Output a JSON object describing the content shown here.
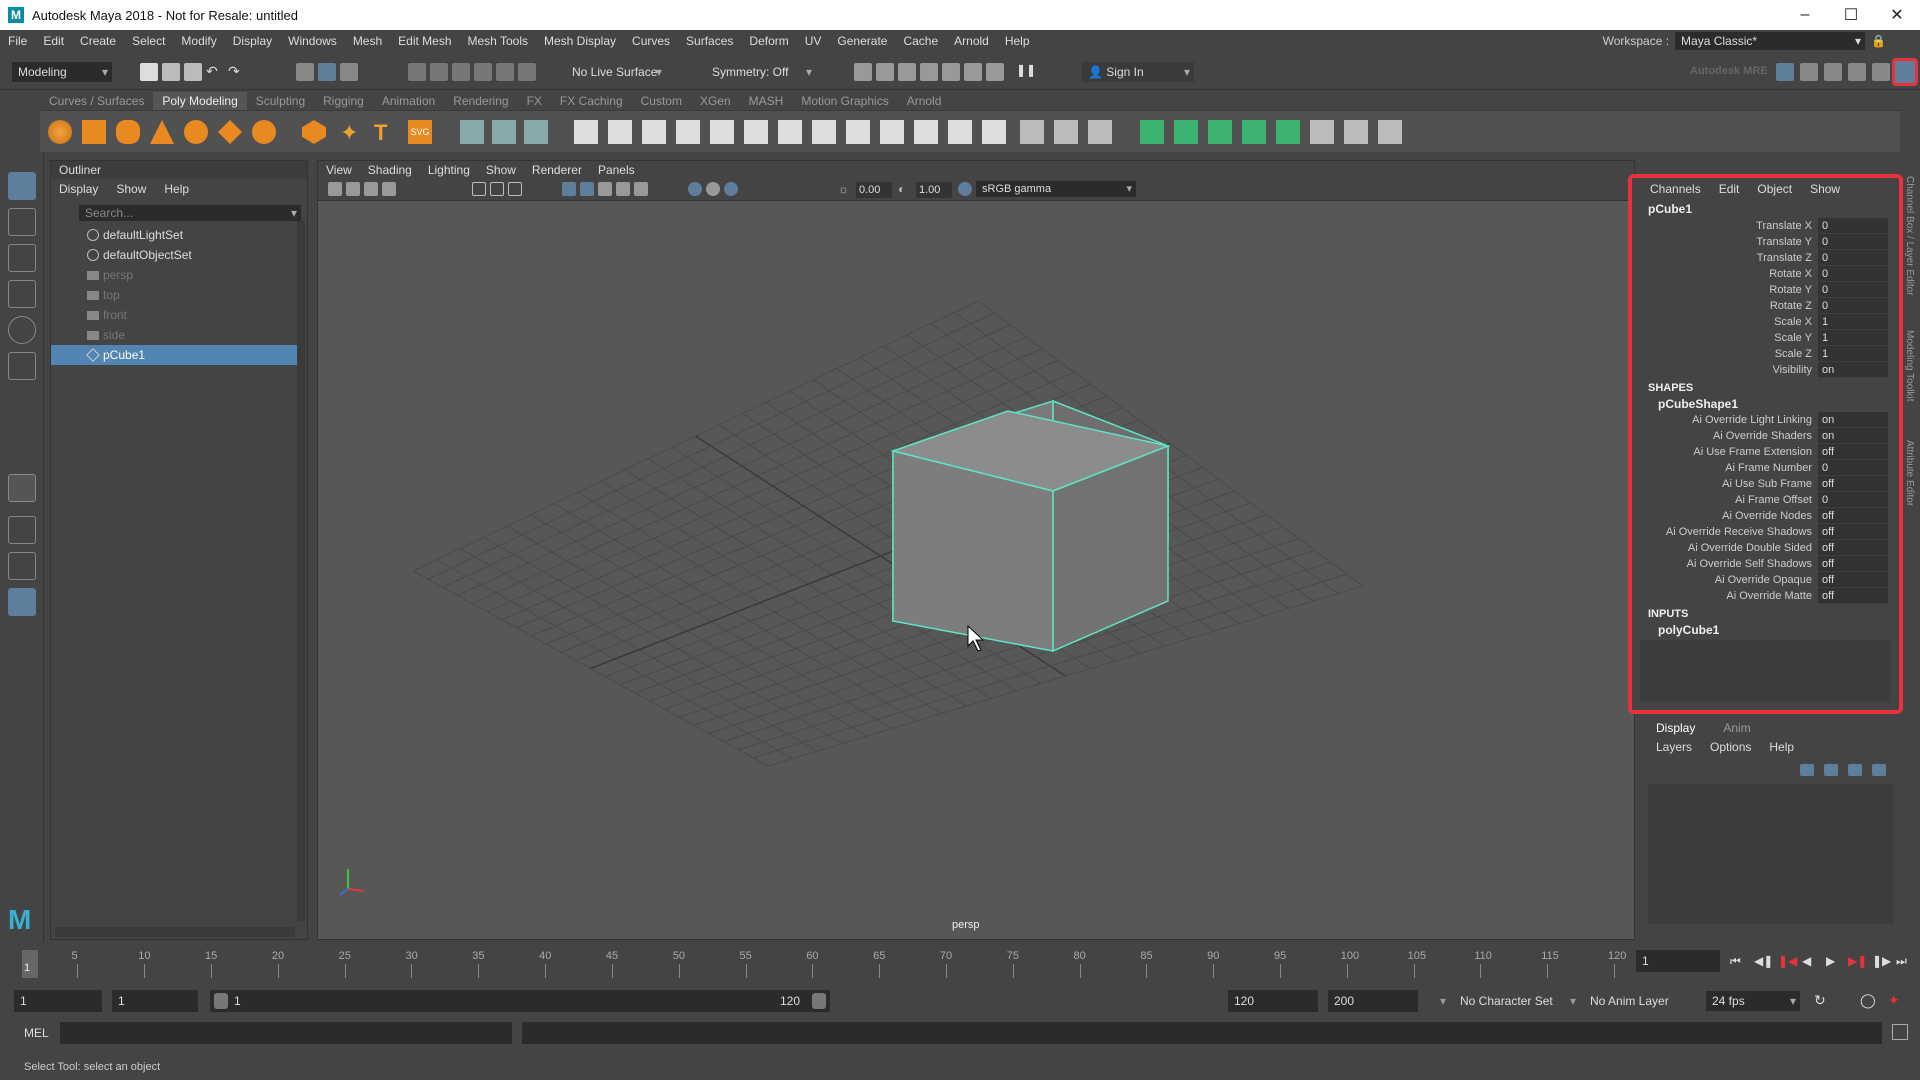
{
  "window": {
    "title": "Autodesk Maya 2018 - Not for Resale: untitled",
    "logo_letter": "M"
  },
  "menubar": {
    "items": [
      "File",
      "Edit",
      "Create",
      "Select",
      "Modify",
      "Display",
      "Windows",
      "Mesh",
      "Edit Mesh",
      "Mesh Tools",
      "Mesh Display",
      "Curves",
      "Surfaces",
      "Deform",
      "UV",
      "Generate",
      "Cache",
      "Arnold",
      "Help"
    ],
    "workspace_label": "Workspace :",
    "workspace_value": "Maya Classic*"
  },
  "statusline": {
    "mode": "Modeling",
    "live_surface": "No Live Surface",
    "symmetry": "Symmetry: Off",
    "sign_in": "Sign In",
    "autodesk_mre": "Autodesk MRE"
  },
  "shelf": {
    "tabs": [
      "Curves / Surfaces",
      "Poly Modeling",
      "Sculpting",
      "Rigging",
      "Animation",
      "Rendering",
      "FX",
      "FX Caching",
      "Custom",
      "XGen",
      "MASH",
      "Motion Graphics",
      "Arnold"
    ],
    "active_tab": "Poly Modeling"
  },
  "outliner": {
    "title": "Outliner",
    "menu": [
      "Display",
      "Show",
      "Help"
    ],
    "search_placeholder": "Search...",
    "items": [
      {
        "label": "defaultLightSet",
        "dim": false,
        "selected": false,
        "icon": "set-icon"
      },
      {
        "label": "defaultObjectSet",
        "dim": false,
        "selected": false,
        "icon": "set-icon"
      },
      {
        "label": "persp",
        "dim": true,
        "selected": false,
        "icon": "camera-icon"
      },
      {
        "label": "top",
        "dim": true,
        "selected": false,
        "icon": "camera-icon"
      },
      {
        "label": "front",
        "dim": true,
        "selected": false,
        "icon": "camera-icon"
      },
      {
        "label": "side",
        "dim": true,
        "selected": false,
        "icon": "camera-icon"
      },
      {
        "label": "pCube1",
        "dim": false,
        "selected": true,
        "icon": "transform-icon"
      }
    ]
  },
  "viewport": {
    "menu": [
      "View",
      "Shading",
      "Lighting",
      "Show",
      "Renderer",
      "Panels"
    ],
    "exposure": "0.00",
    "gamma": "1.00",
    "color_space": "sRGB gamma",
    "camera_label": "persp"
  },
  "channelbox": {
    "menu": [
      "Channels",
      "Edit",
      "Object",
      "Show"
    ],
    "object": "pCube1",
    "transform": [
      {
        "label": "Translate X",
        "value": "0"
      },
      {
        "label": "Translate Y",
        "value": "0"
      },
      {
        "label": "Translate Z",
        "value": "0"
      },
      {
        "label": "Rotate X",
        "value": "0"
      },
      {
        "label": "Rotate Y",
        "value": "0"
      },
      {
        "label": "Rotate Z",
        "value": "0"
      },
      {
        "label": "Scale X",
        "value": "1"
      },
      {
        "label": "Scale Y",
        "value": "1"
      },
      {
        "label": "Scale Z",
        "value": "1"
      },
      {
        "label": "Visibility",
        "value": "on"
      }
    ],
    "shapes_header": "SHAPES",
    "shape_name": "pCubeShape1",
    "shape_attrs": [
      {
        "label": "Ai Override Light Linking",
        "value": "on"
      },
      {
        "label": "Ai Override Shaders",
        "value": "on"
      },
      {
        "label": "Ai Use Frame Extension",
        "value": "off"
      },
      {
        "label": "Ai Frame Number",
        "value": "0"
      },
      {
        "label": "Ai Use Sub Frame",
        "value": "off"
      },
      {
        "label": "Ai Frame Offset",
        "value": "0"
      },
      {
        "label": "Ai Override Nodes",
        "value": "off"
      },
      {
        "label": "Ai Override Receive Shadows",
        "value": "off"
      },
      {
        "label": "Ai Override Double Sided",
        "value": "off"
      },
      {
        "label": "Ai Override Self Shadows",
        "value": "off"
      },
      {
        "label": "Ai Override Opaque",
        "value": "off"
      },
      {
        "label": "Ai Override Matte",
        "value": "off"
      }
    ],
    "inputs_header": "INPUTS",
    "input_name": "polyCube1",
    "highlight_color": "#e8313c"
  },
  "layereditor": {
    "tabs": [
      "Display",
      "Anim"
    ],
    "menu": [
      "Layers",
      "Options",
      "Help"
    ]
  },
  "edgetabs": [
    "Channel Box / Layer Editor",
    "Modeling Toolkit",
    "Attribute Editor"
  ],
  "timeslider": {
    "ticks": [
      "5",
      "10",
      "15",
      "20",
      "25",
      "30",
      "35",
      "40",
      "45",
      "50",
      "55",
      "60",
      "65",
      "70",
      "75",
      "80",
      "85",
      "90",
      "95",
      "100",
      "105",
      "110",
      "115",
      "120"
    ],
    "start_marker": "1",
    "current_frame": "1"
  },
  "range": {
    "start": "1",
    "playback_start": "1",
    "range_start": "1",
    "range_end": "120",
    "playback_end": "120",
    "end": "200",
    "character_set": "No Character Set",
    "anim_layer": "No Anim Layer",
    "fps": "24 fps"
  },
  "cmdline": {
    "lang": "MEL"
  },
  "helpline": {
    "text": "Select Tool: select an object"
  }
}
